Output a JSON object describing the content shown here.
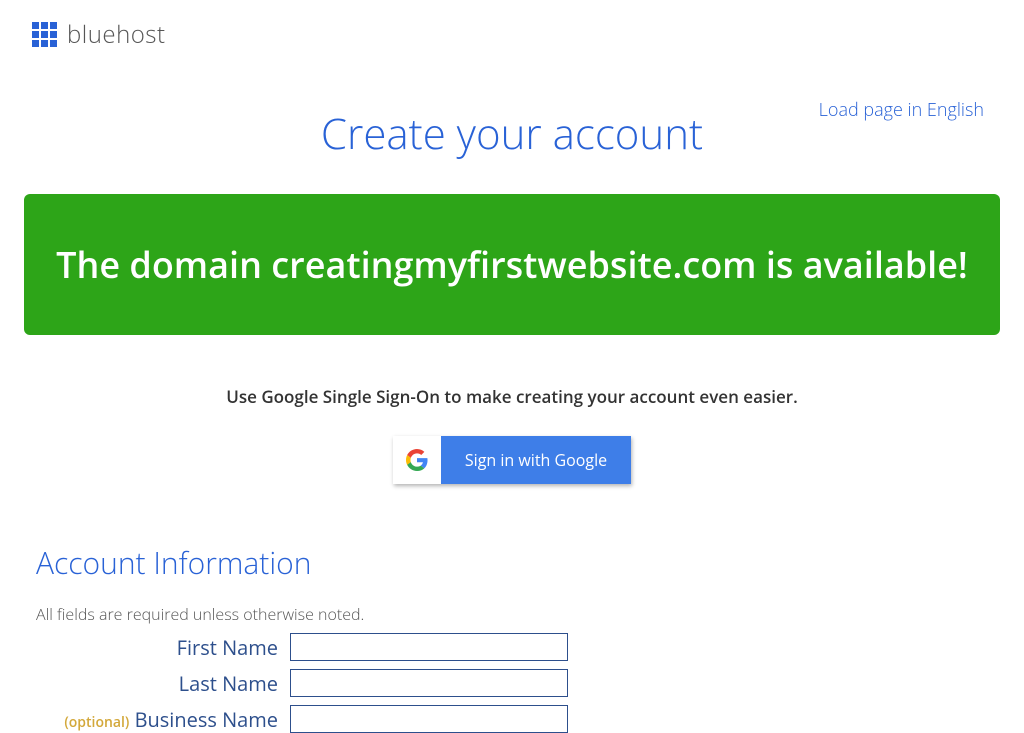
{
  "header": {
    "brand": "bluehost"
  },
  "loadPageLink": "Load page in English",
  "pageTitle": "Create your account",
  "banner": "The domain creatingmyfirstwebsite.com is available!",
  "ssoText": "Use Google Single Sign-On to make creating your account even easier.",
  "googleButton": "Sign in with Google",
  "section": {
    "heading": "Account Information",
    "requiredNote": "All fields are required unless otherwise noted."
  },
  "form": {
    "firstName": {
      "label": "First Name",
      "value": ""
    },
    "lastName": {
      "label": "Last Name",
      "value": ""
    },
    "businessName": {
      "optional": "(optional)",
      "label": "Business Name",
      "value": ""
    }
  }
}
